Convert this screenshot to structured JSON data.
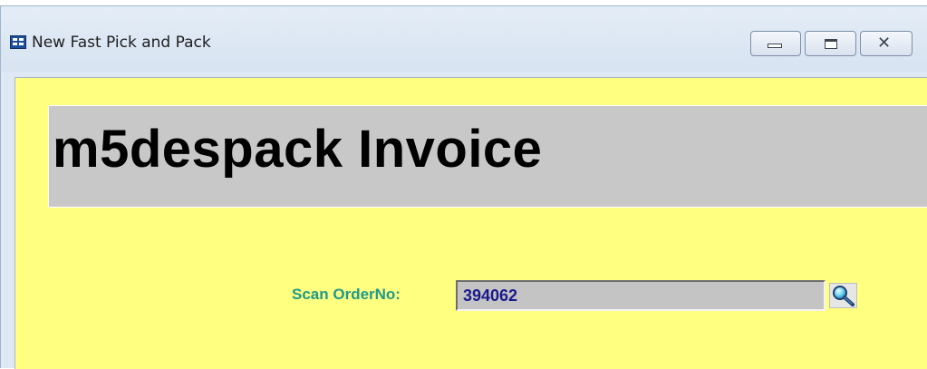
{
  "window": {
    "title": "New Fast Pick and Pack",
    "icon": "form-window-icon",
    "controls": {
      "minimize_icon": "minimize-icon",
      "maximize_icon": "restore-icon",
      "close_icon": "close-icon",
      "close_glyph": "✕"
    }
  },
  "header": {
    "title": "m5despack Invoice"
  },
  "scan": {
    "label": "Scan OrderNo:",
    "value": "394062",
    "lookup_icon": "magnifier-icon"
  },
  "colors": {
    "client_background": "#ffff80",
    "header_background": "#c8c8c8",
    "label_color": "#1f9a8a",
    "input_text": "#1a1a8c"
  }
}
